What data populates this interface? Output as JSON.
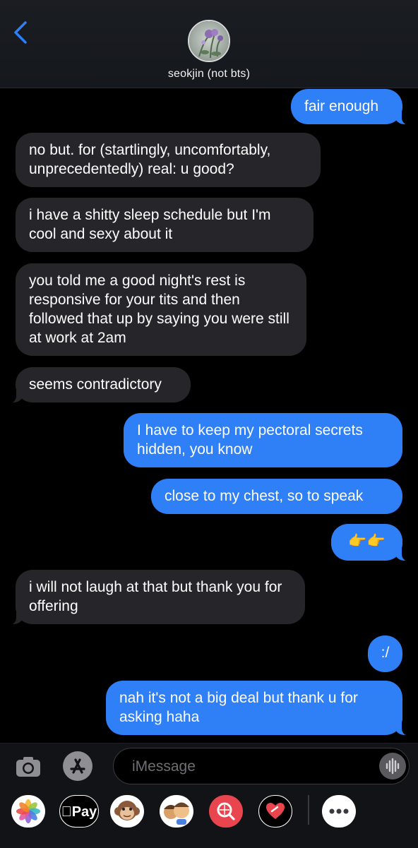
{
  "header": {
    "contact_name": "seokjin (not bts)"
  },
  "messages": [
    {
      "from": "me",
      "text": "fair enough"
    },
    {
      "from": "them",
      "text": "no but. for (startlingly, uncomfortably, unprecedentedly) real: u good?"
    },
    {
      "from": "them",
      "text": "i have a shitty sleep schedule but I'm cool and sexy about it"
    },
    {
      "from": "them",
      "text": "you told me a good night's rest is responsive for your tits and then followed that up by saying you were still at work at 2am"
    },
    {
      "from": "them",
      "text": "seems contradictory"
    },
    {
      "from": "me",
      "text": "I have to keep my pectoral secrets hidden, you know"
    },
    {
      "from": "me",
      "text": "close to my chest, so to speak"
    },
    {
      "from": "me",
      "text": "👉👉"
    },
    {
      "from": "them",
      "text": "i will not laugh at that but thank you for offering"
    },
    {
      "from": "me",
      "text": ":/"
    },
    {
      "from": "me",
      "text": "nah it's not a big deal but thank u for asking haha"
    }
  ],
  "composer": {
    "placeholder": "iMessage",
    "value": ""
  },
  "app_drawer": [
    {
      "name": "photos-app-icon"
    },
    {
      "name": "apple-pay-button",
      "label": "Pay"
    },
    {
      "name": "animoji-monkey-icon"
    },
    {
      "name": "memoji-icon"
    },
    {
      "name": "web-images-search-icon"
    },
    {
      "name": "digital-touch-icon"
    },
    {
      "name": "more-apps-icon"
    }
  ],
  "colors": {
    "sent_bubble": "#2f7ff6",
    "received_bubble": "#26262a",
    "background": "#000000",
    "accent": "#2f7ff6"
  }
}
